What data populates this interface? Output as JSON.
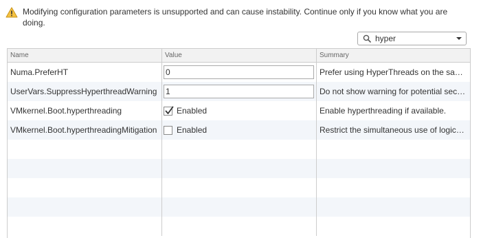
{
  "warning": {
    "icon": "warning-triangle-icon",
    "text": "Modifying configuration parameters is unsupported and can cause instability. Continue only if you know what you are doing."
  },
  "search": {
    "value": "hyper",
    "icon": "search-icon"
  },
  "columns": {
    "name": "Name",
    "value": "Value",
    "summary": "Summary"
  },
  "rows": [
    {
      "name": "Numa.PreferHT",
      "value_type": "text",
      "value": "0",
      "summary": "Prefer using HyperThreads on the same NUMA node"
    },
    {
      "name": "UserVars.SuppressHyperthreadWarning",
      "value_type": "text",
      "value": "1",
      "summary": "Do not show warning for potential security vulnerability"
    },
    {
      "name": "VMkernel.Boot.hyperthreading",
      "value_type": "checkbox",
      "checked": true,
      "value": "Enabled",
      "summary": "Enable hyperthreading if available."
    },
    {
      "name": "VMkernel.Boot.hyperthreadingMitigation",
      "value_type": "checkbox",
      "checked": false,
      "value": "Enabled",
      "summary": "Restrict the simultaneous use of logical processors"
    }
  ],
  "colors": {
    "alt_row": "#f3f6fa",
    "border": "#cccccc",
    "header_bg": "#f2f2f2",
    "warning_fill": "#f5c242"
  }
}
